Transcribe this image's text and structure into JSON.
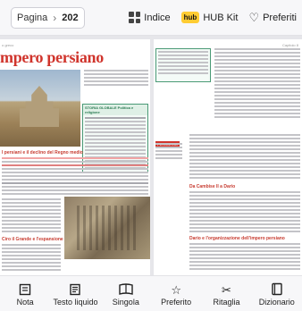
{
  "topbar": {
    "page_label": "Pagina",
    "page_number": "202",
    "index_label": "Indice",
    "hub_badge": "hub",
    "hubkit_label": "HUB Kit",
    "favorites_label": "Preferiti"
  },
  "book": {
    "left_page": {
      "header": "o greco",
      "title": "mpero persiano",
      "box_head": "STORIA GLOBALE   Politica e religione",
      "section_head": "I persiani e il declino del Regno medio",
      "subsection_head": "Ciro il Grande e l'espansione dell'impero persiano"
    },
    "right_page": {
      "header": "Capitolo 8",
      "section1": "Da Cambise II a Dario",
      "section2": "Dario e l'organizzazione dell'impero persiano",
      "tag": "PERCORSO"
    }
  },
  "toolbar": {
    "items": [
      {
        "label": "Nota",
        "icon": "note-icon"
      },
      {
        "label": "Testo liquido",
        "icon": "liquid-text-icon"
      },
      {
        "label": "Singola",
        "icon": "single-page-icon"
      },
      {
        "label": "Preferito",
        "icon": "star-icon"
      },
      {
        "label": "Ritaglia",
        "icon": "scissors-icon"
      },
      {
        "label": "Dizionario",
        "icon": "dictionary-icon"
      }
    ]
  }
}
